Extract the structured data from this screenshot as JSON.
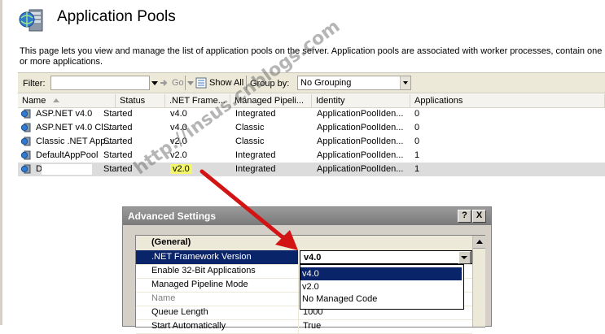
{
  "page": {
    "title": "Application Pools",
    "description": "This page lets you view and manage the list of application pools on the server. Application pools are associated with worker processes, contain one or more applications."
  },
  "toolbar": {
    "filter_label": "Filter:",
    "filter_value": "",
    "go_label": "Go",
    "show_all_label": "Show All",
    "group_by_label": "Group by:",
    "group_by_value": "No Grouping"
  },
  "grid": {
    "columns": [
      "Name",
      "Status",
      ".NET Frame...",
      "Managed Pipeli...",
      "Identity",
      "Applications"
    ],
    "rows": [
      {
        "name": "ASP.NET v4.0",
        "status": "Started",
        "framework": "v4.0",
        "pipeline": "Integrated",
        "identity": "ApplicationPoolIden...",
        "apps": "0"
      },
      {
        "name": "ASP.NET v4.0 Cl...",
        "status": "Started",
        "framework": "v4.0",
        "pipeline": "Classic",
        "identity": "ApplicationPoolIden...",
        "apps": "0"
      },
      {
        "name": "Classic .NET App...",
        "status": "Started",
        "framework": "v2.0",
        "pipeline": "Classic",
        "identity": "ApplicationPoolIden...",
        "apps": "0"
      },
      {
        "name": "DefaultAppPool",
        "status": "Started",
        "framework": "v2.0",
        "pipeline": "Integrated",
        "identity": "ApplicationPoolIden...",
        "apps": "1"
      },
      {
        "name": "D",
        "status": "Started",
        "framework": "v2.0",
        "pipeline": "Integrated",
        "identity": "ApplicationPoolIden...",
        "apps": "1"
      }
    ]
  },
  "watermark": "http://insus.cnblogs.com",
  "dialog": {
    "title": "Advanced Settings",
    "help_button": "?",
    "close_button": "X",
    "category": "(General)",
    "properties": [
      {
        "name": ".NET Framework Version",
        "value": "v4.0"
      },
      {
        "name": "Enable 32-Bit Applications",
        "value": ""
      },
      {
        "name": "Managed Pipeline Mode",
        "value": ""
      },
      {
        "name": "Name",
        "value": ""
      },
      {
        "name": "Queue Length",
        "value": "1000"
      },
      {
        "name": "Start Automatically",
        "value": "True"
      }
    ],
    "dropdown_options": [
      "v4.0",
      "v2.0",
      "No Managed Code"
    ]
  },
  "colors": {
    "selection": "#0a246a",
    "highlight": "#f4f66a",
    "arrow": "#d21414"
  }
}
